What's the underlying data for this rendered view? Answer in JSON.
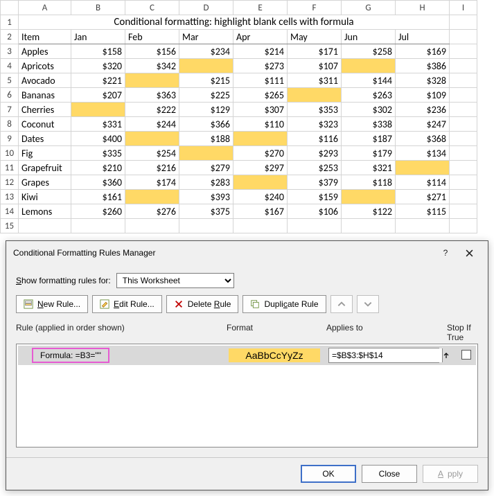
{
  "columns": [
    "A",
    "B",
    "C",
    "D",
    "E",
    "F",
    "G",
    "H",
    "I"
  ],
  "row_numbers": [
    1,
    2,
    3,
    4,
    5,
    6,
    7,
    8,
    9,
    10,
    11,
    12,
    13,
    14,
    15
  ],
  "title": "Conditional formatting: highlight blank cells with formula",
  "headers": [
    "Item",
    "Jan",
    "Feb",
    "Mar",
    "Apr",
    "May",
    "Jun",
    "Jul"
  ],
  "rows": [
    {
      "item": "Apples",
      "vals": [
        "$158",
        "$156",
        "$234",
        "$214",
        "$171",
        "$258",
        "$169"
      ]
    },
    {
      "item": "Apricots",
      "vals": [
        "$320",
        "$342",
        "",
        "$273",
        "$107",
        "",
        "$386"
      ]
    },
    {
      "item": "Avocado",
      "vals": [
        "$221",
        "",
        "$215",
        "$111",
        "$311",
        "$144",
        "$328"
      ]
    },
    {
      "item": "Bananas",
      "vals": [
        "$207",
        "$363",
        "$225",
        "$265",
        "",
        "$263",
        "$109"
      ]
    },
    {
      "item": "Cherries",
      "vals": [
        "",
        "$222",
        "$129",
        "$307",
        "$353",
        "$302",
        "$236"
      ]
    },
    {
      "item": "Coconut",
      "vals": [
        "$331",
        "$244",
        "$366",
        "$110",
        "$323",
        "$338",
        "$247"
      ]
    },
    {
      "item": "Dates",
      "vals": [
        "$400",
        "",
        "$188",
        "",
        "$116",
        "$187",
        "$368"
      ]
    },
    {
      "item": "Fig",
      "vals": [
        "$335",
        "$254",
        "",
        "$270",
        "$293",
        "$179",
        "$134"
      ]
    },
    {
      "item": "Grapefruit",
      "vals": [
        "$210",
        "$216",
        "$279",
        "$297",
        "$253",
        "$321",
        ""
      ]
    },
    {
      "item": "Grapes",
      "vals": [
        "$360",
        "$174",
        "$283",
        "",
        "$379",
        "$118",
        "$114"
      ]
    },
    {
      "item": "Kiwi",
      "vals": [
        "$161",
        "",
        "$393",
        "$240",
        "$159",
        "",
        "$271"
      ]
    },
    {
      "item": "Lemons",
      "vals": [
        "$260",
        "$276",
        "$375",
        "$167",
        "$106",
        "$122",
        "$115"
      ]
    }
  ],
  "dialog": {
    "title": "Conditional Formatting Rules Manager",
    "show_label_pre": "S",
    "show_label_post": "how formatting rules for:",
    "scope_value": "This Worksheet",
    "new_rule_u": "N",
    "new_rule_rest": "ew Rule...",
    "edit_rule_u": "E",
    "edit_rule_rest": "dit Rule...",
    "delete_rule_pre": "Delete ",
    "delete_rule_u": "R",
    "delete_rule_post": "ule",
    "dup_rule_pre": "Dupli",
    "dup_rule_u": "c",
    "dup_rule_post": "ate Rule",
    "col_rule": "Rule (applied in order shown)",
    "col_format": "Format",
    "col_applies": "Applies to",
    "col_stop": "Stop If True",
    "rule_formula": "Formula: =B3=\"\"",
    "format_sample": "AaBbCcYyZz",
    "applies_to": "=$B$3:$H$14",
    "ok": "OK",
    "close": "Close",
    "apply_u": "A",
    "apply_rest": "pply"
  }
}
